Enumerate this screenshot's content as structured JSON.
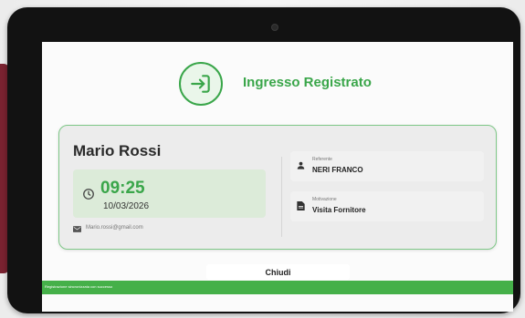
{
  "header": {
    "title": "Ingresso Registrato",
    "icon": "enter-icon",
    "accent_color": "#3aa64a"
  },
  "card": {
    "name": "Mario Rossi",
    "time": "09:25",
    "date": "10/03/2026",
    "email": "Mario.rossi@gmail.com",
    "referente": {
      "label": "Referente",
      "value": "NERI FRANCO",
      "icon": "person-icon"
    },
    "motivazione": {
      "label": "Motivazione",
      "value": "Visita Fornitore",
      "icon": "document-icon"
    }
  },
  "actions": {
    "close_label": "Chiudi"
  },
  "snackbar": {
    "text": "Registrazione sincronizzata con successo",
    "color": "#45b049"
  }
}
